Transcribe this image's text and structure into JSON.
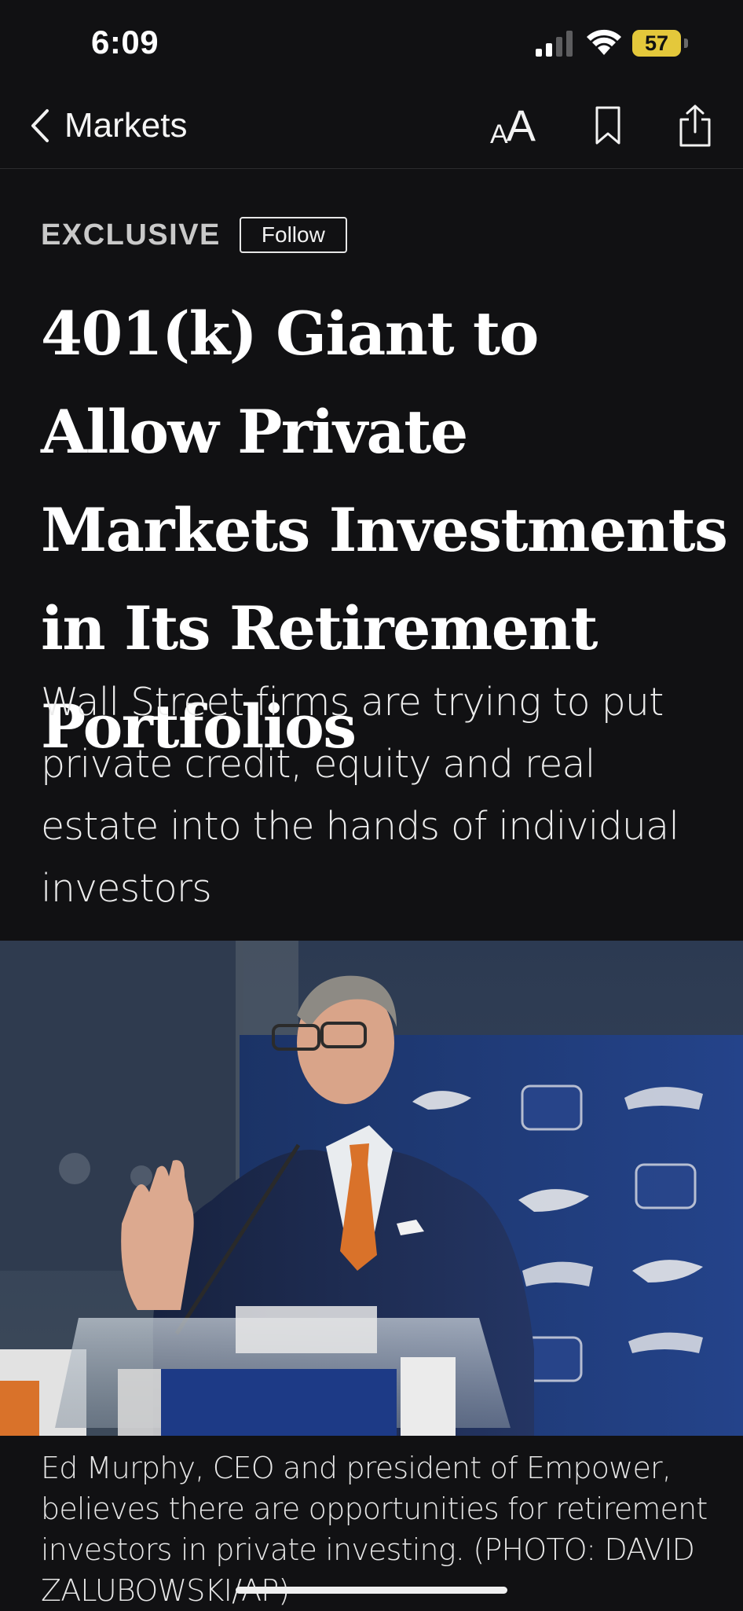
{
  "status_bar": {
    "time": "6:09",
    "battery_percent": "57",
    "battery_color": "#e4c83b"
  },
  "nav": {
    "back_label": "Markets",
    "text_size_icon_small": "A",
    "text_size_icon_big": "A",
    "icons": [
      "chevron-left-icon",
      "text-size-icon",
      "bookmark-icon",
      "share-icon"
    ]
  },
  "article": {
    "flag": "EXCLUSIVE",
    "follow_label": "Follow",
    "headline": "401(k) Giant to Allow Private Markets Investments in Its Retirement Portfolios",
    "dek": "Wall Street firms are trying to put private credit, equity and real estate into the hands of individual investors",
    "photo_caption": "Ed Murphy, CEO and president of Empower, believes there are opportunities for retirement investors in private investing. (PHOTO: DAVID ZALUBOWSKI/AP)"
  },
  "colors": {
    "background": "#111113",
    "text": "#ffffff",
    "backdrop_blue": "#1f3c7a",
    "accent_orange": "#d9722a"
  }
}
